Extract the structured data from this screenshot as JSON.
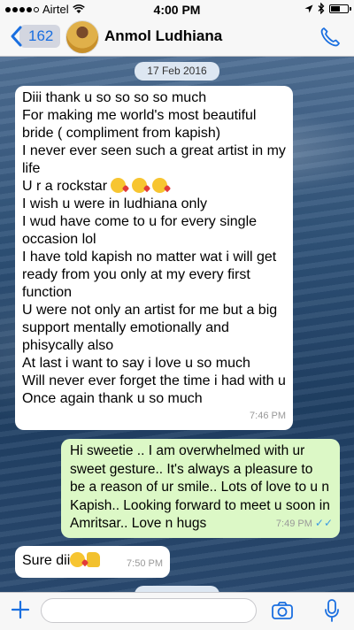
{
  "status_bar": {
    "carrier": "Airtel",
    "time": "4:00 PM",
    "icons": [
      "signal-dots-icon",
      "wifi-icon",
      "location-icon",
      "bluetooth-icon",
      "battery-icon"
    ]
  },
  "header": {
    "back_count": "162",
    "contact_name": "Anmol Ludhiana",
    "call_icon": "phone-icon"
  },
  "chat": {
    "date_divider": "17 Feb 2016",
    "messages": [
      {
        "direction": "incoming",
        "text": "Diii thank u so so so so much\nFor making me world's most beautiful bride ( compliment from kapish)\nI never ever seen such a great artist in my life\nU r a rockstar",
        "text_after_emoji": "I wish u were in ludhiana only\nI wud have come to u for every single occasion lol\nI have told kapish no matter wat i will get ready from you only at my every first function\nU were not only an artist for me but a big support mentally emotionally and phisycally also\nAt last i want to say i love u so much\nWill never ever forget the time i had with u\nOnce again thank u so much",
        "emoji": "kiss-emoji x3",
        "time": "7:46 PM"
      },
      {
        "direction": "outgoing",
        "text": "Hi sweetie .. I am overwhelmed with ur sweet gesture.. It's always a pleasure to be a reason of ur smile.. Lots of love to u n Kapish.. Looking forward to meet u soon in Amritsar.. Love n hugs",
        "time": "7:49 PM",
        "status": "read-double-tick"
      },
      {
        "direction": "incoming",
        "text": "Sure dii",
        "emoji": "kiss-emoji thumbs-up-emoji",
        "time": "7:50 PM"
      }
    ]
  },
  "input_bar": {
    "placeholder": "",
    "icons": [
      "plus-icon",
      "camera-icon",
      "microphone-icon"
    ]
  },
  "colors": {
    "accent": "#1a6fe0",
    "outgoing_bubble": "#dcf8c6",
    "incoming_bubble": "#ffffff",
    "read_tick": "#3b9ae1"
  }
}
